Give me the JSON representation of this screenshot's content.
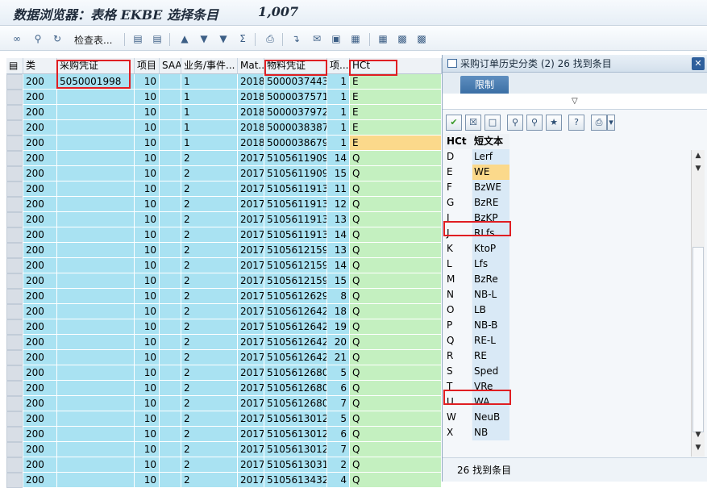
{
  "window": {
    "title": "数据浏览器：表格 EKBE 选择条目",
    "count": "1,007"
  },
  "toolbar": {
    "check_table_label": "检查表..."
  },
  "grid": {
    "headers": [
      "类",
      "采购凭证",
      "项目",
      "SAA",
      "业务/事件...",
      "Mat...",
      "物料凭证",
      "项...",
      "HCt"
    ],
    "rows": [
      [
        "200",
        "5050001998",
        "10",
        "",
        "1",
        "2018",
        "5000037443",
        "1",
        "E"
      ],
      [
        "200",
        "",
        "10",
        "",
        "1",
        "2018",
        "5000037571",
        "1",
        "E"
      ],
      [
        "200",
        "",
        "10",
        "",
        "1",
        "2018",
        "5000037972",
        "1",
        "E"
      ],
      [
        "200",
        "",
        "10",
        "",
        "1",
        "2018",
        "5000038387",
        "1",
        "E"
      ],
      [
        "200",
        "",
        "10",
        "",
        "1",
        "2018",
        "5000038679",
        "1",
        "E"
      ],
      [
        "200",
        "",
        "10",
        "",
        "2",
        "2017",
        "5105611909",
        "14",
        "Q"
      ],
      [
        "200",
        "",
        "10",
        "",
        "2",
        "2017",
        "5105611909",
        "15",
        "Q"
      ],
      [
        "200",
        "",
        "10",
        "",
        "2",
        "2017",
        "5105611913",
        "11",
        "Q"
      ],
      [
        "200",
        "",
        "10",
        "",
        "2",
        "2017",
        "5105611913",
        "12",
        "Q"
      ],
      [
        "200",
        "",
        "10",
        "",
        "2",
        "2017",
        "5105611913",
        "13",
        "Q"
      ],
      [
        "200",
        "",
        "10",
        "",
        "2",
        "2017",
        "5105611913",
        "14",
        "Q"
      ],
      [
        "200",
        "",
        "10",
        "",
        "2",
        "2017",
        "5105612159",
        "13",
        "Q"
      ],
      [
        "200",
        "",
        "10",
        "",
        "2",
        "2017",
        "5105612159",
        "14",
        "Q"
      ],
      [
        "200",
        "",
        "10",
        "",
        "2",
        "2017",
        "5105612159",
        "15",
        "Q"
      ],
      [
        "200",
        "",
        "10",
        "",
        "2",
        "2017",
        "5105612629",
        "8",
        "Q"
      ],
      [
        "200",
        "",
        "10",
        "",
        "2",
        "2017",
        "5105612642",
        "18",
        "Q"
      ],
      [
        "200",
        "",
        "10",
        "",
        "2",
        "2017",
        "5105612642",
        "19",
        "Q"
      ],
      [
        "200",
        "",
        "10",
        "",
        "2",
        "2017",
        "5105612642",
        "20",
        "Q"
      ],
      [
        "200",
        "",
        "10",
        "",
        "2",
        "2017",
        "5105612642",
        "21",
        "Q"
      ],
      [
        "200",
        "",
        "10",
        "",
        "2",
        "2017",
        "5105612680",
        "5",
        "Q"
      ],
      [
        "200",
        "",
        "10",
        "",
        "2",
        "2017",
        "5105612680",
        "6",
        "Q"
      ],
      [
        "200",
        "",
        "10",
        "",
        "2",
        "2017",
        "5105612680",
        "7",
        "Q"
      ],
      [
        "200",
        "",
        "10",
        "",
        "2",
        "2017",
        "5105613012",
        "5",
        "Q"
      ],
      [
        "200",
        "",
        "10",
        "",
        "2",
        "2017",
        "5105613012",
        "6",
        "Q"
      ],
      [
        "200",
        "",
        "10",
        "",
        "2",
        "2017",
        "5105613012",
        "7",
        "Q"
      ],
      [
        "200",
        "",
        "10",
        "",
        "2",
        "2017",
        "5105613031",
        "2",
        "Q"
      ],
      [
        "200",
        "",
        "10",
        "",
        "2",
        "2017",
        "5105613432",
        "4",
        "Q"
      ]
    ],
    "highlighted_row": 4
  },
  "popup": {
    "title": "采购订单历史分类 (2)   26 找到条目",
    "tab": "限制",
    "header_key": "HCt",
    "header_text": "短文本",
    "status": "26 找到条目",
    "items": [
      {
        "key": "D",
        "text": "Lerf"
      },
      {
        "key": "E",
        "text": "WE"
      },
      {
        "key": "F",
        "text": "BzWE"
      },
      {
        "key": "G",
        "text": "BzRE"
      },
      {
        "key": "I",
        "text": "BzKP"
      },
      {
        "key": "J",
        "text": "RLfs"
      },
      {
        "key": "K",
        "text": "KtoP"
      },
      {
        "key": "L",
        "text": "Lfs"
      },
      {
        "key": "M",
        "text": "BzRe"
      },
      {
        "key": "N",
        "text": "NB-L"
      },
      {
        "key": "O",
        "text": "LB"
      },
      {
        "key": "P",
        "text": "NB-B"
      },
      {
        "key": "Q",
        "text": "RE-L"
      },
      {
        "key": "R",
        "text": "RE"
      },
      {
        "key": "S",
        "text": "Sped"
      },
      {
        "key": "T",
        "text": "VRe"
      },
      {
        "key": "U",
        "text": "WA"
      },
      {
        "key": "W",
        "text": "NeuB"
      },
      {
        "key": "X",
        "text": "NB"
      }
    ],
    "selected_index": 1
  },
  "colors": {
    "grid_blue": "#a9e2f2",
    "hct_green": "#c4f0c0",
    "highlight": "#fbd98b",
    "red_box": "#e01e22"
  }
}
